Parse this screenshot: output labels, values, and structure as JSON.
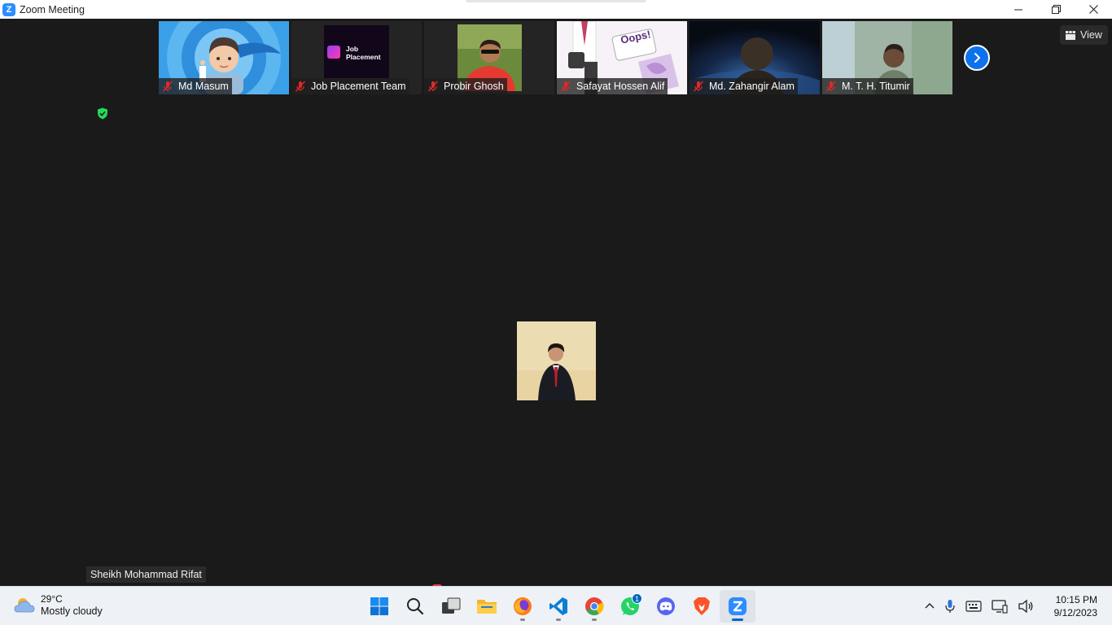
{
  "window": {
    "title": "Zoom Meeting",
    "logo_letter": "Z"
  },
  "participants": [
    {
      "name": "Md Masum"
    },
    {
      "name": "Job Placement Team",
      "logo_text_line1": "Job",
      "logo_text_line2": "Placement"
    },
    {
      "name": "Probir Ghosh"
    },
    {
      "name": "Safayat Hossen Alif",
      "image_text": "Oops!"
    },
    {
      "name": "Md. Zahangir Alam"
    },
    {
      "name": "M. T. H. Titumir"
    }
  ],
  "view_button": {
    "label": "View"
  },
  "speaker": {
    "name": "Sheikh Mohammad Rifat"
  },
  "taskbar": {
    "weather": {
      "temp": "29°C",
      "desc": "Mostly cloudy"
    },
    "apps": [
      "start",
      "search",
      "task-view",
      "file-explorer",
      "firefox",
      "vscode",
      "chrome",
      "whatsapp",
      "discord",
      "brave",
      "zoom"
    ],
    "whatsapp_badge": "1",
    "clock": {
      "time": "10:15 PM",
      "date": "9/12/2023"
    }
  },
  "colors": {
    "accent": "#0e72ed",
    "mute": "#e02828",
    "shield": "#23d959"
  }
}
